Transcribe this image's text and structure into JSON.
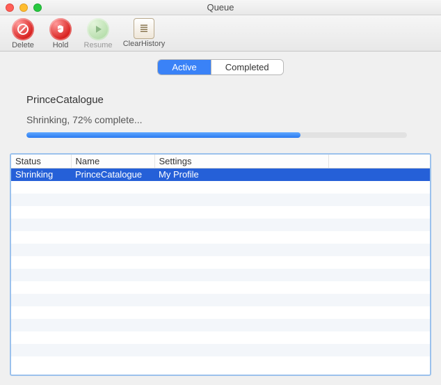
{
  "window": {
    "title": "Queue"
  },
  "toolbar": {
    "delete_label": "Delete",
    "hold_label": "Hold",
    "resume_label": "Resume",
    "clearhistory_label": "ClearHistory"
  },
  "tabs": {
    "active_label": "Active",
    "completed_label": "Completed",
    "selected": "Active"
  },
  "current_job": {
    "name": "PrinceCatalogue",
    "status_text": "Shrinking, 72% complete...",
    "progress_percent": 72
  },
  "columns": {
    "status": "Status",
    "name": "Name",
    "settings": "Settings"
  },
  "rows": [
    {
      "status": "Shrinking",
      "name": "PrinceCatalogue",
      "settings": "My Profile",
      "selected": true
    }
  ],
  "colors": {
    "accent": "#2a7af0",
    "selection": "#2560d8"
  }
}
